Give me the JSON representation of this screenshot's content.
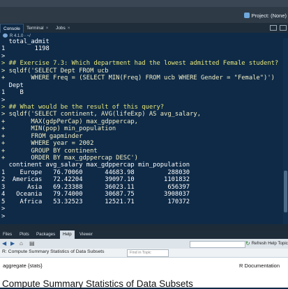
{
  "window": {
    "project_label": "Project: (None)"
  },
  "pane_tabs": [
    {
      "label": "Console",
      "active": true
    },
    {
      "label": "Terminal",
      "closable": true
    },
    {
      "label": "Jobs",
      "closable": true
    }
  ],
  "r_version": "R 4.1.0 · ~/",
  "console_lines": [
    {
      "cls": "out",
      "text": "  total_admit"
    },
    {
      "cls": "out",
      "text": "1        1198"
    },
    {
      "cls": "prompt",
      "text": ">"
    },
    {
      "cls": "cmt",
      "text": "> ## Exercise 7.3: Which department had the lowest admitted Female student?"
    },
    {
      "cls": "code",
      "text": "> sqldf('SELECT Dept FROM ucb"
    },
    {
      "cls": "code",
      "text": "+       WHERE Freq = (SELECT MIN(Freq) FROM ucb WHERE Gender = \"Female\")')"
    },
    {
      "cls": "out",
      "text": "  Dept"
    },
    {
      "cls": "out",
      "text": "1    B"
    },
    {
      "cls": "prompt",
      "text": ">"
    },
    {
      "cls": "cmt",
      "text": "> ## What would be the result of this query?"
    },
    {
      "cls": "code",
      "text": "> sqldf('SELECT continent, AVG(lifeExp) AS avg_salary,"
    },
    {
      "cls": "code",
      "text": "+       MAX(gdpPerCap) max_gdppercap,"
    },
    {
      "cls": "code",
      "text": "+       MIN(pop) min_population"
    },
    {
      "cls": "code",
      "text": "+       FROM gapminder"
    },
    {
      "cls": "code",
      "text": "+       WHERE year = 2002"
    },
    {
      "cls": "code",
      "text": "+       GROUP BY continent"
    },
    {
      "cls": "code",
      "text": "+       ORDER BY max_gdppercap DESC')"
    },
    {
      "cls": "out",
      "text": "  continent avg_salary max_gdppercap min_population"
    },
    {
      "cls": "out",
      "text": "1    Europe   76.70060      44683.98         288030"
    },
    {
      "cls": "out",
      "text": "2  Americas   72.42204      39097.10        1101832"
    },
    {
      "cls": "out",
      "text": "3      Asia   69.23388      36023.11         656397"
    },
    {
      "cls": "out",
      "text": "4   Oceania   79.74000      30687.75        3908037"
    },
    {
      "cls": "out",
      "text": "5    Africa   53.32523      12521.71         170372"
    },
    {
      "cls": "prompt",
      "text": ">"
    },
    {
      "cls": "prompt",
      "text": ">"
    }
  ],
  "help_tabs": [
    {
      "label": "Files"
    },
    {
      "label": "Plots"
    },
    {
      "label": "Packages"
    },
    {
      "label": "Help",
      "active": true
    },
    {
      "label": "Viewer"
    }
  ],
  "help": {
    "toolbar_refresh": "Refresh Help Topic",
    "title_bar": "R: Compute Summary Statistics of Data Subsets",
    "find_topic_placeholder": "Find in Topic",
    "topic": "aggregate {stats}",
    "doc_label": "R Documentation",
    "heading": "Compute Summary Statistics of Data Subsets"
  }
}
